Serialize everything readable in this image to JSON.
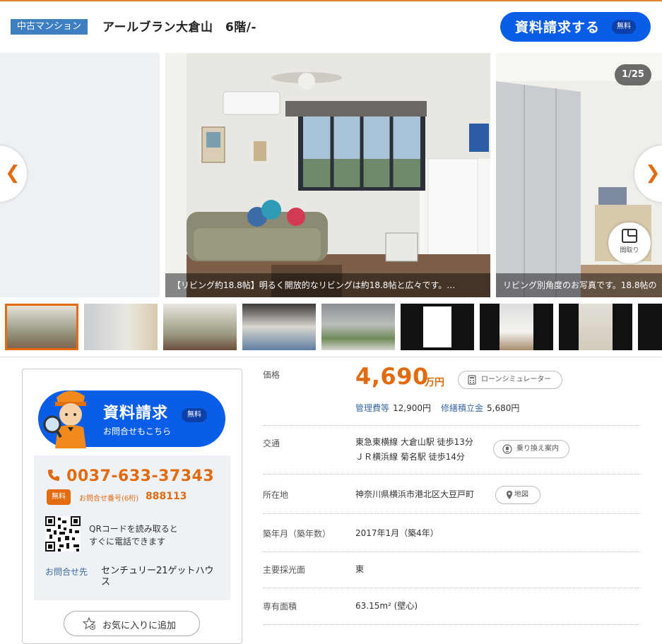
{
  "header": {
    "tag": "中古マンション",
    "title": "アールブラン大倉山　6階/-",
    "request_label": "資料請求する",
    "free_label": "無料"
  },
  "gallery": {
    "counter": "1/25",
    "main_caption": "【リビング約18.8帖】明るく開放的なリビングは約18.8帖と広々です。…",
    "side_caption": "リビング別角度のお写真です。18.8帖の",
    "madori_label": "間取り",
    "prev_icon": "chevron-left-icon",
    "next_icon": "chevron-right-icon",
    "thumbnail_count": 9,
    "selected_thumbnail": 1
  },
  "contact": {
    "request_main": "資料請求",
    "request_sub": "お問合せもこちら",
    "free_label": "無料",
    "phone": "0037-633-37343",
    "free_badge": "無料",
    "inquiry_label": "お問合せ番号(6桁)",
    "inquiry_number": "888113",
    "qr_text_1": "QRコードを読み取ると",
    "qr_text_2": "すぐに電話できます",
    "agent_label": "お問合せ先",
    "agent_name": "センチュリー21ゲットハウス",
    "favorite_label": "お気に入りに追加"
  },
  "details": {
    "price_label": "価格",
    "price": "4,690",
    "price_unit": "万円",
    "loan_button": "ローンシミュレーター",
    "mgmt_label": "管理費等",
    "mgmt_value": "12,900円",
    "repair_label": "修繕積立金",
    "repair_value": "5,680円",
    "access_label": "交通",
    "access_line1": "東急東横線 大倉山駅 徒歩13分",
    "access_line2": "ＪＲ横浜線 菊名駅 徒歩14分",
    "transfer_button": "乗り換え案内",
    "address_label": "所在地",
    "address": "神奈川県横浜市港北区大豆戸町",
    "map_button": "地図",
    "built_label": "築年月（築年数）",
    "built_value": "2017年1月（築4年）",
    "light_label": "主要採光面",
    "light_value": "東",
    "area_label": "専有面積",
    "area_value": "63.15m² (壁心)"
  },
  "colors": {
    "accent_orange": "#e26a0f",
    "brand_blue": "#0a5de6",
    "tag_blue": "#3d7fc1"
  }
}
